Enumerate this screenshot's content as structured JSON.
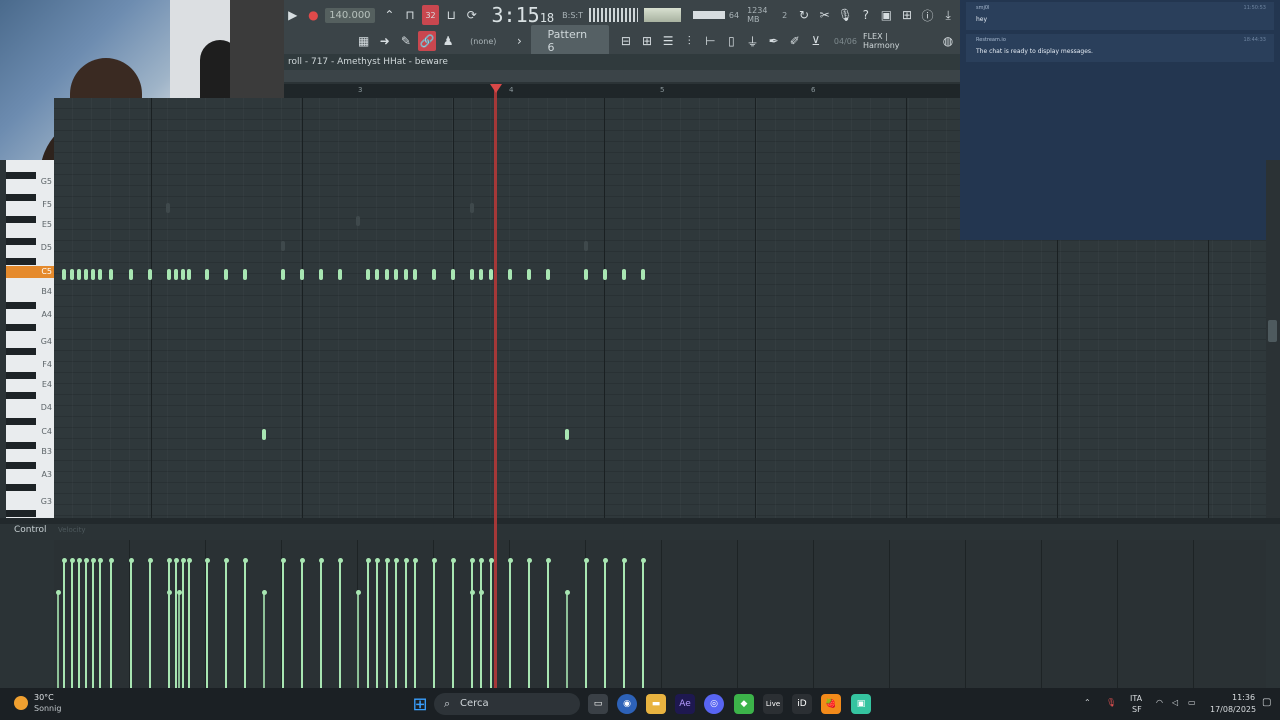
{
  "toolbar": {
    "tempo": "140.000",
    "time": "3:15",
    "time_small": "18",
    "time_tiny": "B:S:T",
    "counter_a": "32",
    "meter_value": "64",
    "memory": "1234 MB",
    "memory_sub": "2",
    "channel_none": "(none)",
    "pattern": "Pattern 6",
    "flex_date": "04/06",
    "flex_label": "FLEX | Harmony"
  },
  "title": "roll - 717 - Amethyst HHat - beware",
  "ruler": [
    "3",
    "4",
    "5",
    "6"
  ],
  "chat": {
    "messages": [
      {
        "user": "smj0l",
        "time": "11:50:53",
        "text": "hey"
      },
      {
        "user": "Restream.io",
        "time": "18:44:33",
        "text": "The chat is ready to display messages."
      }
    ]
  },
  "keys": [
    "G5",
    "F5",
    "E5",
    "D5",
    "C5",
    "B4",
    "A4",
    "G4",
    "F4",
    "E4",
    "D4",
    "C4",
    "B3",
    "A3",
    "G3"
  ],
  "control": {
    "label": "Control",
    "sub": "Velocity"
  },
  "taskbar": {
    "weather_temp": "30°C",
    "weather_cond": "Sonnig",
    "search": "Cerca",
    "lang": "ITA",
    "lang_sub": "SF",
    "clock_time": "11:36",
    "clock_date": "17/08/2025"
  }
}
